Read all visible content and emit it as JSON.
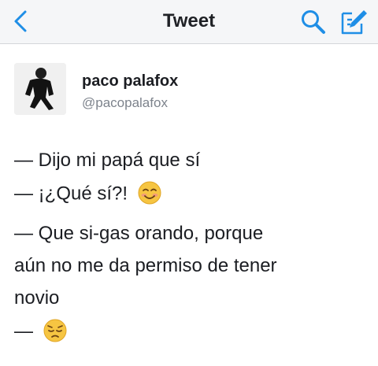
{
  "header": {
    "title": "Tweet",
    "back_icon": "chevron-left-icon",
    "search_icon": "search-icon",
    "compose_icon": "compose-icon",
    "accent_color": "#1f8ee6"
  },
  "tweet": {
    "author_name": "paco palafox",
    "author_handle": "@pacopalafox",
    "lines": [
      "— Dijo mi papá que sí",
      "— ¡¿Qué sí?!",
      "— Que si-gas orando, porque",
      "aún no me da permiso de tener",
      "novio",
      "—"
    ],
    "emojis": [
      "smiling-face-emoji",
      "pensive-face-emoji"
    ]
  }
}
